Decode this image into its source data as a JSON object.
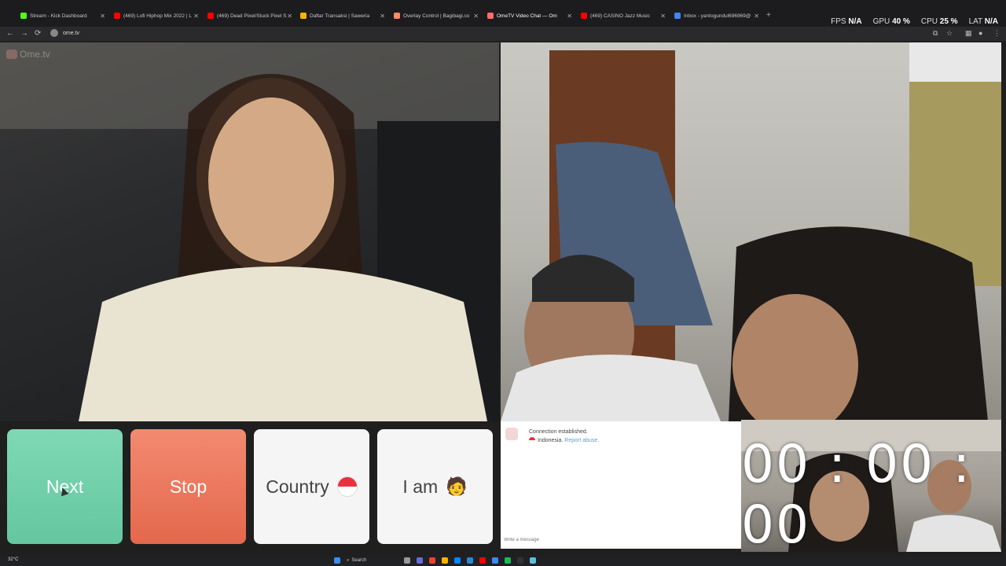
{
  "browser": {
    "tabs": [
      {
        "label": "Stream - Kick Dashboard",
        "color": "#53fc18"
      },
      {
        "label": "(469) Lofi Hiphop Mix 2022 | L",
        "color": "#ff0000"
      },
      {
        "label": "(469) Dead Pixel/Stuck Pixel S",
        "color": "#ff0000"
      },
      {
        "label": "Daftar Transaksi | Saweria",
        "color": "#f5b400"
      },
      {
        "label": "Overlay Control | Bagibagi.co",
        "color": "#ff8a65"
      },
      {
        "label": "OmeTV Video Chat — Om",
        "color": "#ff6b6b",
        "active": true
      },
      {
        "label": "(469) CASINO Jazz Music",
        "color": "#ff0000"
      },
      {
        "label": "Inbox - yantogundul696969@",
        "color": "#4285f4"
      }
    ],
    "url": "ome.tv",
    "perf": {
      "fps_label": "FPS",
      "fps_value": "N/A",
      "gpu_label": "GPU",
      "gpu_value": "40",
      "cpu_label": "CPU",
      "cpu_value": "25",
      "lat_label": "LAT",
      "lat_value": "N/A"
    }
  },
  "logo_text": "Ome.tv",
  "buttons": {
    "next": "Next",
    "stop": "Stop",
    "country": "Country",
    "iam": "I am"
  },
  "chat": {
    "status": "Connection established.",
    "country": "Indonesia.",
    "report": "Report abuse.",
    "placeholder": "Write a message"
  },
  "timer": "00 : 00 : 00",
  "taskbar": {
    "weather": "32°C",
    "search": "Search"
  },
  "colors": {
    "next": "#6fcfaa",
    "stop": "#ea745a",
    "accent_link": "#5aa0c8"
  }
}
